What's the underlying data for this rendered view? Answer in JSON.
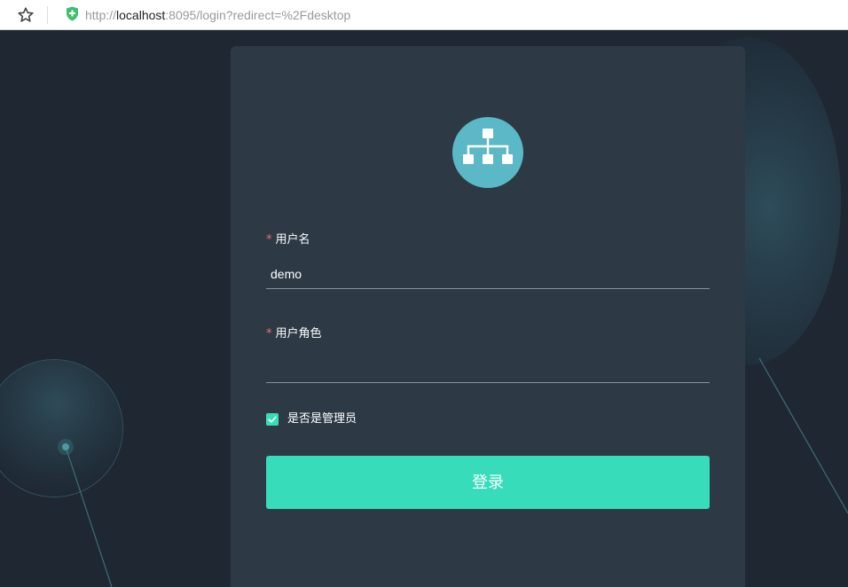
{
  "browser": {
    "url_scheme": "http://",
    "url_host": "localhost",
    "url_rest": ":8095/login?redirect=%2Fdesktop",
    "icons": [
      "star-icon",
      "shield-icon"
    ]
  },
  "login": {
    "logo_icon": "sitemap-icon",
    "username": {
      "required_mark": "*",
      "label": "用户名",
      "value": "demo"
    },
    "role": {
      "required_mark": "*",
      "label": "用户角色",
      "value": ""
    },
    "admin_checkbox": {
      "label": "是否是管理员",
      "checked": true
    },
    "submit_label": "登录"
  },
  "colors": {
    "background": "#1f2733",
    "card": "#2d3a46",
    "accent": "#37ddbb",
    "logo": "#5bb9c7",
    "required": "#f56c6c"
  }
}
